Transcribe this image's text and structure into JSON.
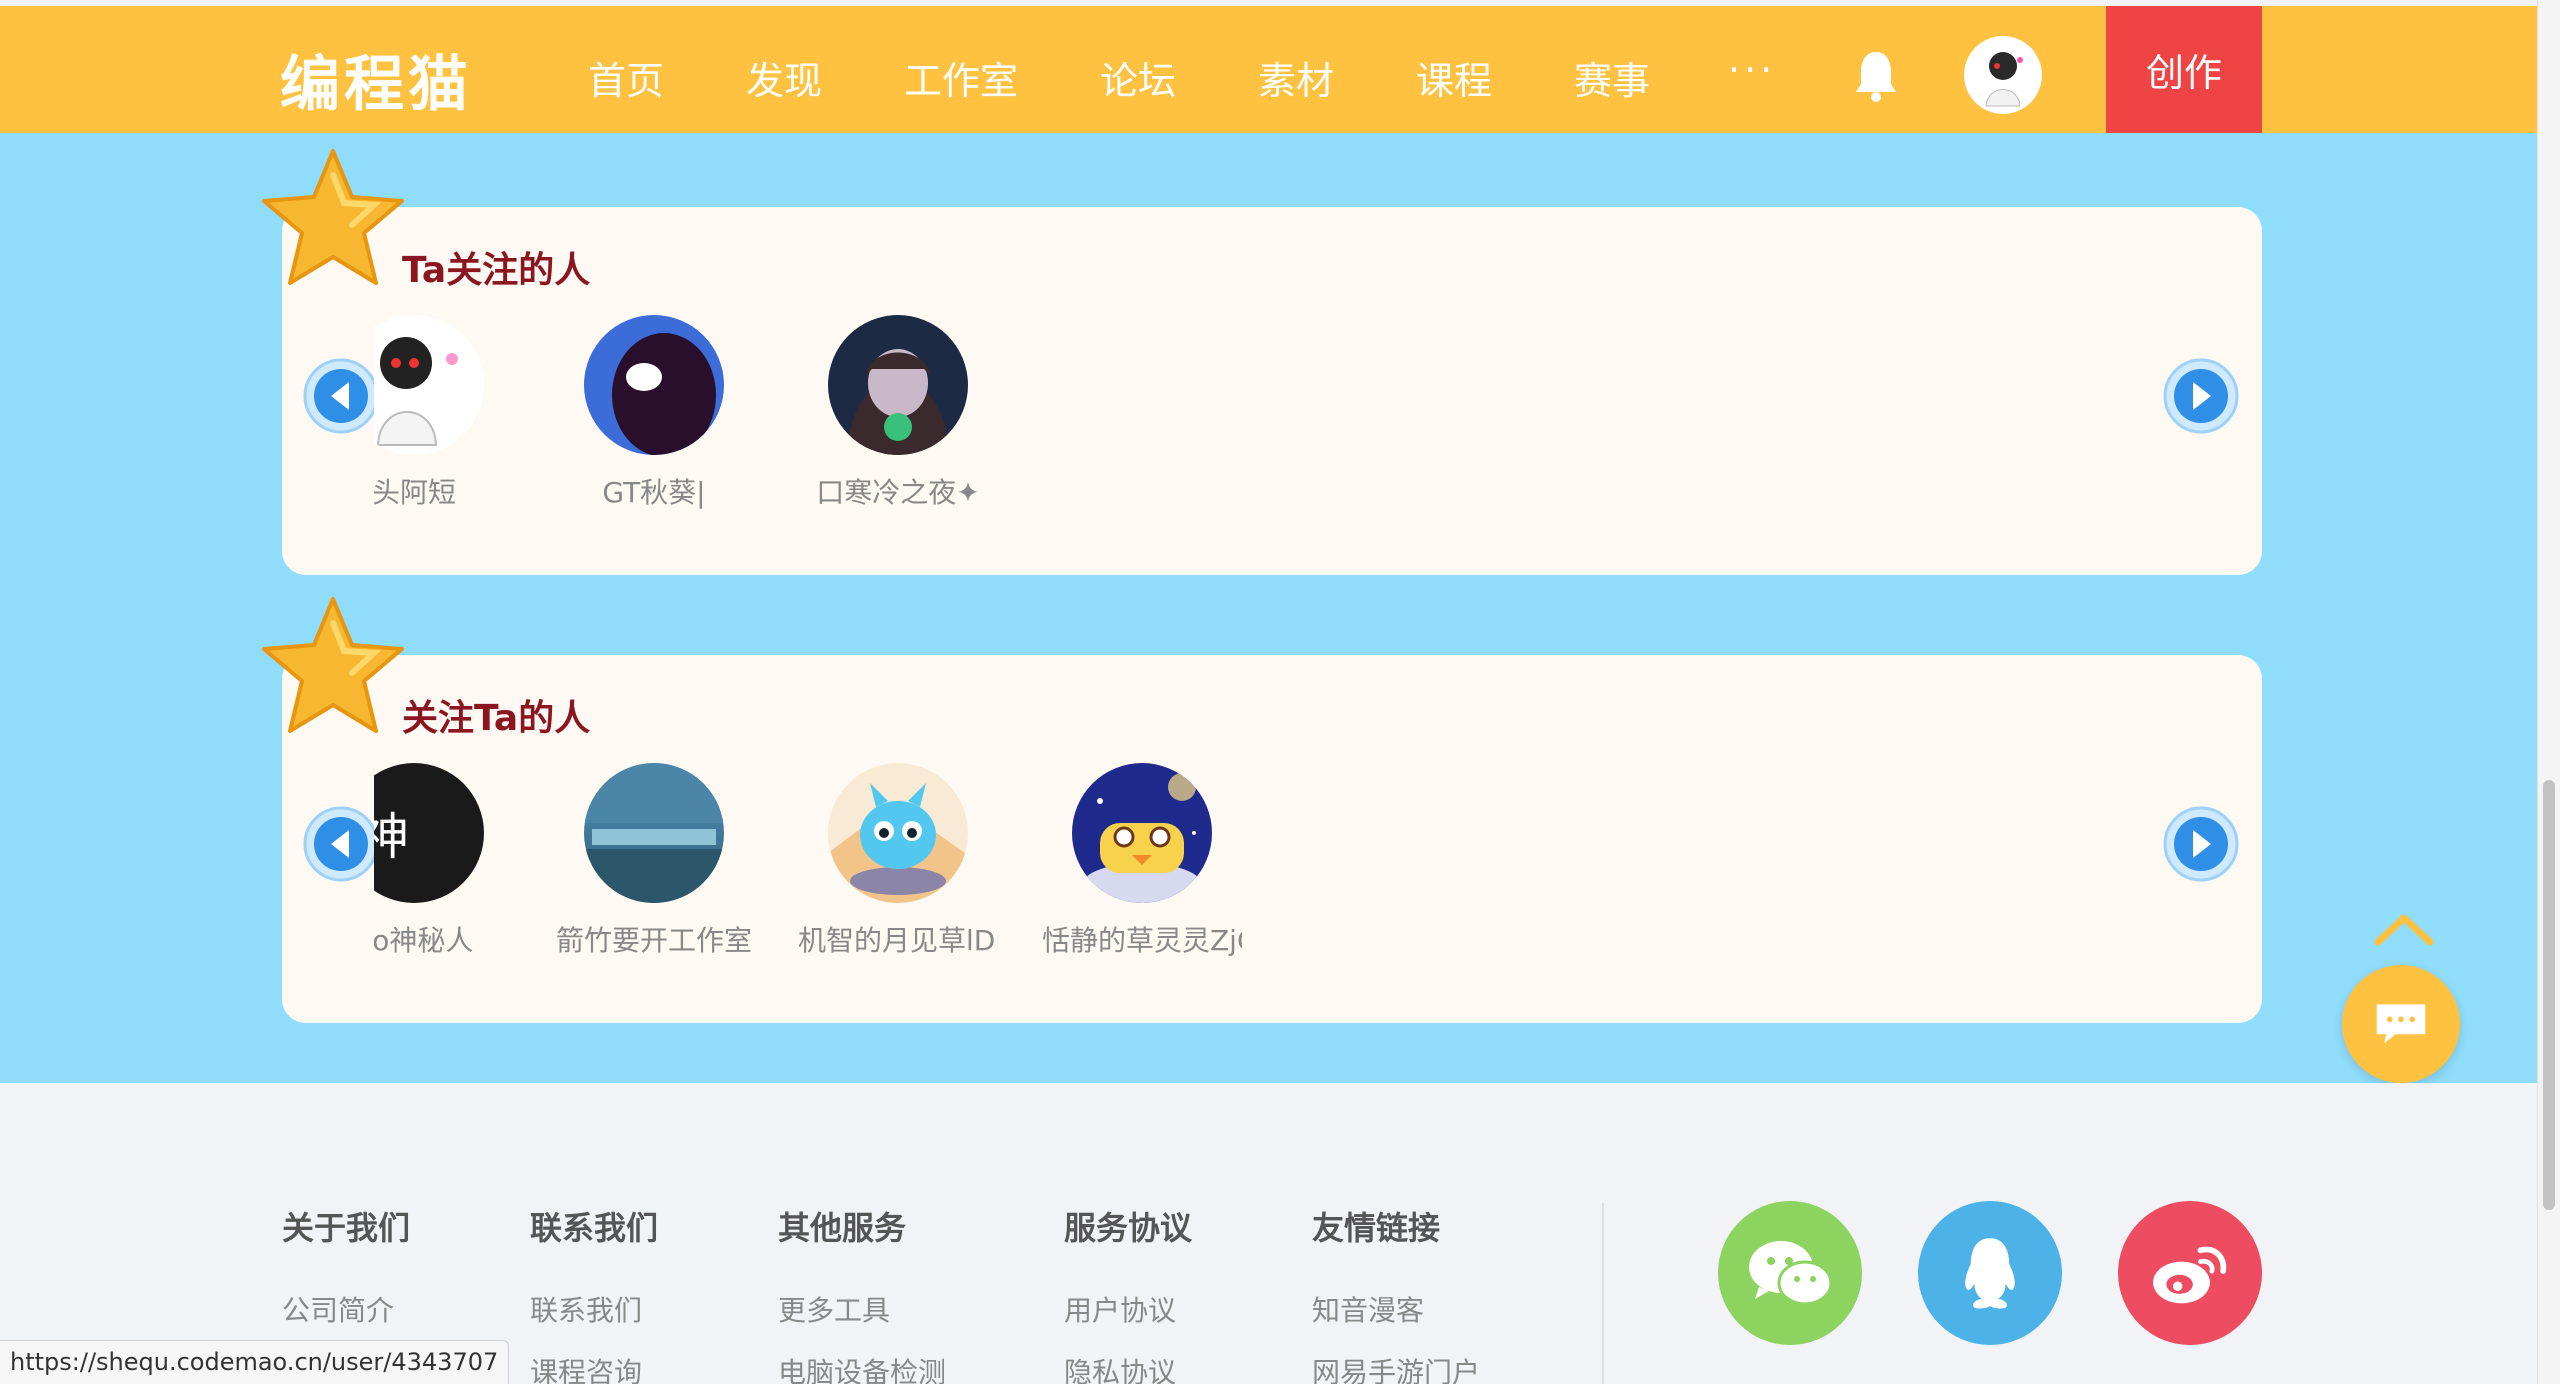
{
  "header": {
    "logo": "编程猫",
    "nav": [
      "首页",
      "发现",
      "工作室",
      "论坛",
      "素材",
      "课程",
      "赛事"
    ],
    "more": "···",
    "create_label": "创作"
  },
  "following": {
    "title": "Ta关注的人",
    "users": [
      {
        "name": "头阿短",
        "icon": "avatar-white-hood"
      },
      {
        "name": "GT秋葵|",
        "icon": "avatar-dark-blob"
      },
      {
        "name": "口寒冷之夜✦",
        "icon": "avatar-anime-girl"
      }
    ]
  },
  "followers": {
    "title": "关注Ta的人",
    "users": [
      {
        "name": "no神秘人",
        "icon": "avatar-shen-char",
        "glyph": "神"
      },
      {
        "name": "箭竹要开工作室",
        "icon": "avatar-scenery"
      },
      {
        "name": "机智的月见草lDr",
        "icon": "avatar-blue-monster"
      },
      {
        "name": "恬静的草灵灵ZjC",
        "icon": "avatar-yellow-ship"
      }
    ]
  },
  "footer": {
    "columns": [
      {
        "title": "关于我们",
        "links": [
          "公司简介"
        ]
      },
      {
        "title": "联系我们",
        "links": [
          "联系我们",
          "课程咨询"
        ]
      },
      {
        "title": "其他服务",
        "links": [
          "更多工具",
          "电脑设备检测"
        ]
      },
      {
        "title": "服务协议",
        "links": [
          "用户协议",
          "隐私协议"
        ]
      },
      {
        "title": "友情链接",
        "links": [
          "知音漫客",
          "网易手游门户"
        ]
      }
    ],
    "social": [
      {
        "name": "wechat",
        "color": "#8dd35f"
      },
      {
        "name": "qq",
        "color": "#4db2e7"
      },
      {
        "name": "weibo",
        "color": "#ee4d61"
      }
    ]
  },
  "status_url": "https://shequ.codemao.cn/user/4343707",
  "colors": {
    "header": "#fec140",
    "create": "#ef4444",
    "main": "#8fdcfb",
    "panel": "#fefaf3",
    "title": "#8b1622"
  }
}
